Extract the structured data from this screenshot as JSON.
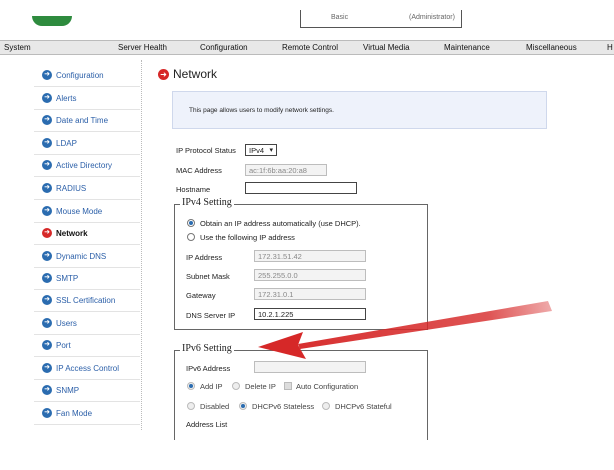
{
  "topbar": {
    "field_left": "Basic",
    "field_right": "(Administrator)"
  },
  "nav": [
    "System",
    "Server Health",
    "Configuration",
    "Remote Control",
    "Virtual Media",
    "Maintenance",
    "Miscellaneous",
    "H"
  ],
  "sidebar": [
    "Configuration",
    "Alerts",
    "Date and Time",
    "LDAP",
    "Active Directory",
    "RADIUS",
    "Mouse Mode",
    "Network",
    "Dynamic DNS",
    "SMTP",
    "SSL Certification",
    "Users",
    "Port",
    "IP Access Control",
    "SNMP",
    "Fan Mode"
  ],
  "sidebar_active": "Network",
  "page": {
    "title": "Network",
    "info": "This page allows users to modify network settings."
  },
  "form": {
    "ip_protocol_label": "IP Protocol Status",
    "ip_protocol_value": "IPv4",
    "mac_label": "MAC Address",
    "mac_value": "ac:1f:6b:aa:20:a8",
    "hostname_label": "Hostname",
    "hostname_value": ""
  },
  "ipv4": {
    "legend": "IPv4 Setting",
    "opt_dhcp": "Obtain an IP address automatically (use DHCP).",
    "opt_static": "Use the following IP address",
    "ip_label": "IP Address",
    "ip_value": "172.31.51.42",
    "mask_label": "Subnet Mask",
    "mask_value": "255.255.0.0",
    "gw_label": "Gateway",
    "gw_value": "172.31.0.1",
    "dns_label": "DNS Server IP",
    "dns_value": "10.2.1.225"
  },
  "ipv6": {
    "legend": "IPv6 Setting",
    "addr_label": "IPv6 Address",
    "add_ip": "Add IP",
    "delete_ip": "Delete IP",
    "auto_config": "Auto Configuration",
    "disabled": "Disabled",
    "stateless": "DHCPv6 Stateless",
    "stateful": "DHCPv6 Stateful",
    "address_list": "Address List"
  },
  "colors": {
    "accent": "#2b6cb0",
    "active": "#d62828",
    "arrow": "#d62828"
  }
}
